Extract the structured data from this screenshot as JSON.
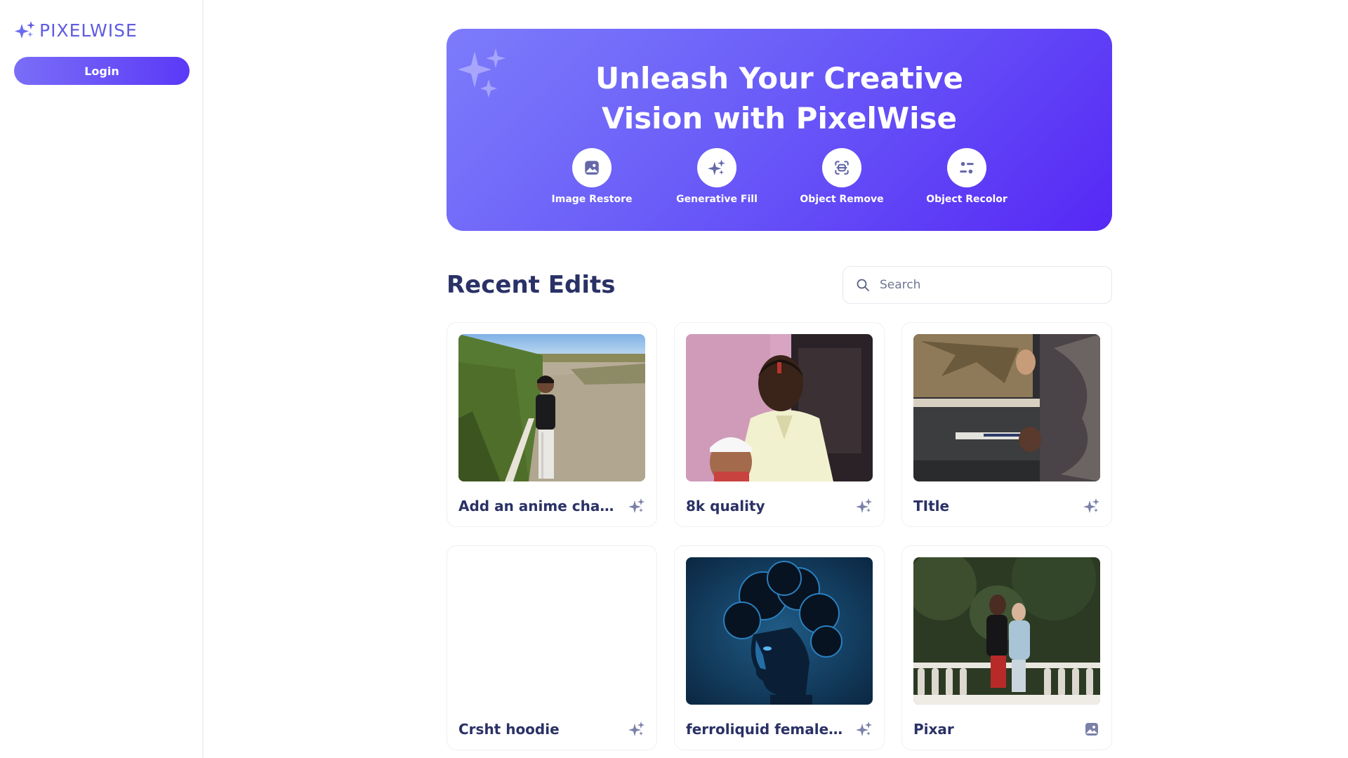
{
  "brand": {
    "name": "PIXELWISE",
    "accent": "#5f5ce0"
  },
  "sidebar": {
    "login_label": "Login"
  },
  "hero": {
    "title_line1": "Unleash Your Creative",
    "title_line2": "Vision with PixelWise",
    "tools": [
      {
        "label": "Image Restore",
        "icon": "image-icon"
      },
      {
        "label": "Generative Fill",
        "icon": "sparkles-icon"
      },
      {
        "label": "Object Remove",
        "icon": "scan-icon"
      },
      {
        "label": "Object Recolor",
        "icon": "filter-icon"
      }
    ]
  },
  "recent": {
    "title": "Recent Edits",
    "search_placeholder": "Search",
    "items": [
      {
        "title": "Add an anime charact...",
        "icon": "sparkles-icon"
      },
      {
        "title": "8k quality",
        "icon": "sparkles-icon"
      },
      {
        "title": "TItle",
        "icon": "sparkles-icon"
      },
      {
        "title": "Crsht hoodie",
        "icon": "sparkles-icon"
      },
      {
        "title": "ferroliquid female art",
        "icon": "sparkles-icon"
      },
      {
        "title": "Pixar",
        "icon": "image-icon"
      }
    ]
  }
}
